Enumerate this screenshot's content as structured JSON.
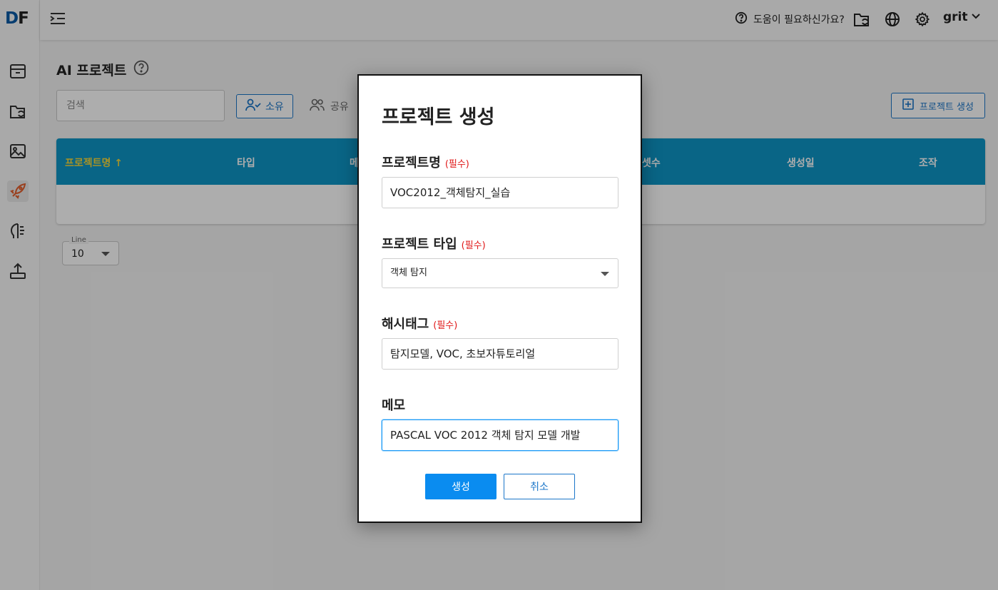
{
  "app": {
    "logo_d": "D",
    "logo_f": "F",
    "user_name": "grit"
  },
  "topbar": {
    "help_text": "도움이 필요하신가요?"
  },
  "sidebar": {
    "items": [
      {
        "icon": "archive-box-icon"
      },
      {
        "icon": "folder-sync-icon"
      },
      {
        "icon": "image-gallery-icon"
      },
      {
        "icon": "rocket-icon"
      },
      {
        "icon": "brain-icon"
      },
      {
        "icon": "upload-icon"
      }
    ]
  },
  "page": {
    "title": "AI 프로젝트",
    "search_placeholder": "검색",
    "filter_own": "소유",
    "filter_share": "공유",
    "create_button": "프로젝트 생성",
    "line_label": "Line",
    "line_value": "10"
  },
  "table": {
    "headers": [
      "프로젝트명",
      "타입",
      "메",
      "셋수",
      "생성일",
      "조작"
    ],
    "sort_indicator": "↑"
  },
  "modal": {
    "title": "프로젝트 생성",
    "required_mark": "(필수)",
    "fields": {
      "name": {
        "label": "프로젝트명",
        "value": "VOC2012_객체탐지_실습"
      },
      "type": {
        "label": "프로젝트 타입",
        "value": "객체 탐지"
      },
      "hashtag": {
        "label": "해시태그",
        "value": "탐지모델, VOC, 초보자튜토리얼"
      },
      "memo": {
        "label": "메모",
        "value": "PASCAL VOC 2012 객체 탐지 모델 개발"
      }
    },
    "submit_label": "생성",
    "cancel_label": "취소"
  },
  "colors": {
    "accent": "#1b76c9",
    "table_header": "#0e95c6",
    "primary_button": "#0a8cf0",
    "required": "#e01818"
  }
}
